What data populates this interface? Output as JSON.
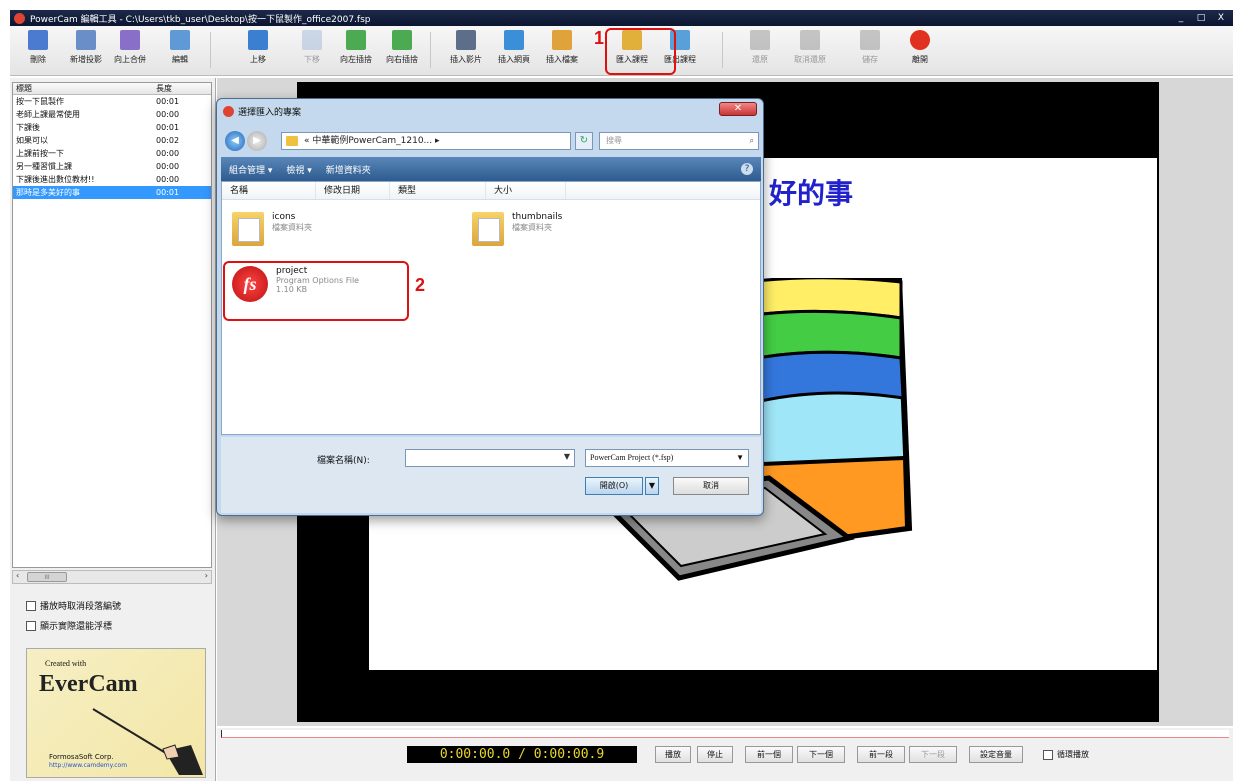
{
  "window": {
    "title": "PowerCam 編輯工具 - C:\\Users\\tkb_user\\Desktop\\按一下鼠製作_office2007.fsp",
    "controls": [
      "_",
      "□",
      "X"
    ]
  },
  "toolbar": {
    "buttons": [
      {
        "label": "刪除",
        "icon": "delete-icon",
        "color": "#4a7bd0"
      },
      {
        "label": "新增投影",
        "icon": "new-slide-icon",
        "color": "#6a8fc8"
      },
      {
        "label": "向上合併",
        "icon": "merge-up-icon",
        "color": "#8a6fc8"
      },
      {
        "label": "編輯",
        "icon": "edit-icon",
        "color": "#5f9ad6"
      },
      {
        "label": "上移",
        "icon": "move-up-icon",
        "color": "#3b7fd0"
      },
      {
        "label": "下移",
        "icon": "move-down-icon",
        "color": "#9ab4d6",
        "disabled": true
      },
      {
        "label": "向左插捨",
        "icon": "rotate-left-icon",
        "color": "#4caa52"
      },
      {
        "label": "向右插捨",
        "icon": "rotate-right-icon",
        "color": "#4caa52"
      },
      {
        "label": "插入影片",
        "icon": "insert-video-icon",
        "color": "#5c6e8a"
      },
      {
        "label": "插入網頁",
        "icon": "insert-webpage-icon",
        "color": "#3a8fd8"
      },
      {
        "label": "插入檔案",
        "icon": "insert-file-icon",
        "color": "#e0a23a"
      },
      {
        "label": "匯入課程",
        "icon": "import-course-icon",
        "color": "#e0b03a"
      },
      {
        "label": "匯出課程",
        "icon": "export-course-icon",
        "color": "#5aa0d8"
      },
      {
        "label": "還原",
        "icon": "undo-icon",
        "color": "#8a8a8a",
        "disabled": true
      },
      {
        "label": "取消還原",
        "icon": "redo-icon",
        "color": "#8a8a8a",
        "disabled": true
      },
      {
        "label": "儲存",
        "icon": "save-icon",
        "color": "#8a8a8a",
        "disabled": true
      },
      {
        "label": "離開",
        "icon": "power-icon",
        "color": "#e03020"
      }
    ],
    "annotation_1": "1"
  },
  "slide_list": {
    "headers": [
      "標題",
      "長度"
    ],
    "rows": [
      {
        "title": "按一下鼠製作",
        "length": "00:01"
      },
      {
        "title": "老師上課最常使用",
        "length": "00:00"
      },
      {
        "title": "下課後",
        "length": "00:01"
      },
      {
        "title": "如果可以",
        "length": "00:02"
      },
      {
        "title": "上課前按一下",
        "length": "00:00"
      },
      {
        "title": "另一種習慣上課",
        "length": "00:00"
      },
      {
        "title": "下課後進出數位教材!!",
        "length": "00:00"
      },
      {
        "title": "那時是多美好的事",
        "length": "00:01",
        "selected": true
      }
    ],
    "scroll_left": "‹",
    "scroll_thumb": "III",
    "scroll_right": "›"
  },
  "options": {
    "option1": "播放時取消段落編號",
    "option2": "顯示實際還能浮標"
  },
  "logo": {
    "created": "Created with",
    "brand": "EverCam",
    "company": "FormosaSoft Corp.",
    "url": "http://www.camdemy.com"
  },
  "slide": {
    "text": "好的事"
  },
  "playback": {
    "timecode": "0:00:00.0 / 0:00:00.9",
    "buttons": [
      {
        "label": "播放"
      },
      {
        "label": "停止"
      },
      {
        "label": "前一個"
      },
      {
        "label": "下一個"
      },
      {
        "label": "前一段"
      },
      {
        "label": "下一段",
        "disabled": true
      },
      {
        "label": "設定音量"
      }
    ],
    "loop_label": "循環播放"
  },
  "dialog": {
    "title": "選擇匯入的專案",
    "close": "✕",
    "address": "« 中華範例PowerCam_1210... ▸",
    "search_placeholder": "搜尋",
    "commands": [
      "組合管理 ▾",
      "檢視 ▾",
      "新增資料夾"
    ],
    "help": "?",
    "columns": [
      "名稱",
      "修改日期",
      "類型",
      "大小"
    ],
    "files": [
      {
        "name": "icons",
        "sub": "檔案資料夾"
      },
      {
        "name": "thumbnails",
        "sub": "檔案資料夾"
      },
      {
        "name": "project",
        "sub": "Program Options File",
        "size": "1.10 KB"
      }
    ],
    "annotation_2": "2",
    "filename_label": "檔案名稱(N):",
    "filename_value": "",
    "filetype": "PowerCam Project (*.fsp)",
    "open_label": "開啟(O)",
    "cancel_label": "取消"
  }
}
